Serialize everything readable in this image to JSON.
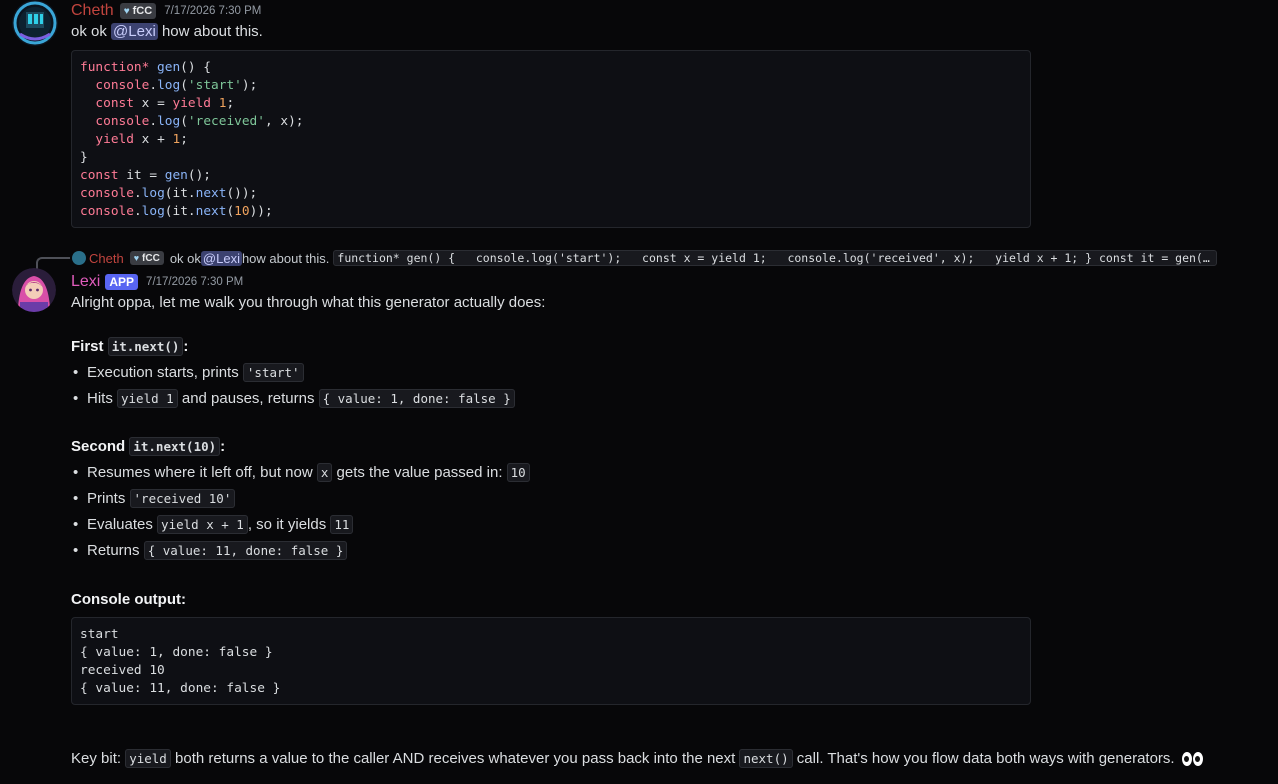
{
  "message1": {
    "author": "Cheth",
    "tag": "fCC",
    "timestamp": "7/17/2026 7:30 PM",
    "text_before": "ok ok ",
    "mention": "@Lexi",
    "text_after": " how about this.",
    "code_lines": [
      [
        {
          "t": "kw",
          "s": "function* "
        },
        {
          "t": "fn",
          "s": "gen"
        },
        {
          "t": "plain",
          "s": "() {"
        }
      ],
      [
        {
          "t": "plain",
          "s": "  "
        },
        {
          "t": "kw",
          "s": "console"
        },
        {
          "t": "plain",
          "s": "."
        },
        {
          "t": "fn",
          "s": "log"
        },
        {
          "t": "plain",
          "s": "("
        },
        {
          "t": "str",
          "s": "'start'"
        },
        {
          "t": "plain",
          "s": ");"
        }
      ],
      [
        {
          "t": "plain",
          "s": "  "
        },
        {
          "t": "kw",
          "s": "const"
        },
        {
          "t": "plain",
          "s": " x = "
        },
        {
          "t": "kw",
          "s": "yield"
        },
        {
          "t": "plain",
          "s": " "
        },
        {
          "t": "num",
          "s": "1"
        },
        {
          "t": "plain",
          "s": ";"
        }
      ],
      [
        {
          "t": "plain",
          "s": "  "
        },
        {
          "t": "kw",
          "s": "console"
        },
        {
          "t": "plain",
          "s": "."
        },
        {
          "t": "fn",
          "s": "log"
        },
        {
          "t": "plain",
          "s": "("
        },
        {
          "t": "str",
          "s": "'received'"
        },
        {
          "t": "plain",
          "s": ", x);"
        }
      ],
      [
        {
          "t": "plain",
          "s": "  "
        },
        {
          "t": "kw",
          "s": "yield"
        },
        {
          "t": "plain",
          "s": " x + "
        },
        {
          "t": "num",
          "s": "1"
        },
        {
          "t": "plain",
          "s": ";"
        }
      ],
      [
        {
          "t": "plain",
          "s": "}"
        }
      ],
      [
        {
          "t": "kw",
          "s": "const"
        },
        {
          "t": "plain",
          "s": " it = "
        },
        {
          "t": "fn",
          "s": "gen"
        },
        {
          "t": "plain",
          "s": "();"
        }
      ],
      [
        {
          "t": "kw",
          "s": "console"
        },
        {
          "t": "plain",
          "s": "."
        },
        {
          "t": "fn",
          "s": "log"
        },
        {
          "t": "plain",
          "s": "(it."
        },
        {
          "t": "fn",
          "s": "next"
        },
        {
          "t": "plain",
          "s": "());"
        }
      ],
      [
        {
          "t": "kw",
          "s": "console"
        },
        {
          "t": "plain",
          "s": "."
        },
        {
          "t": "fn",
          "s": "log"
        },
        {
          "t": "plain",
          "s": "(it."
        },
        {
          "t": "fn",
          "s": "next"
        },
        {
          "t": "plain",
          "s": "("
        },
        {
          "t": "num",
          "s": "10"
        },
        {
          "t": "plain",
          "s": "));"
        }
      ]
    ]
  },
  "reply_preview": {
    "author": "Cheth",
    "tag": "fCC",
    "text_before": "ok ok ",
    "mention": "@Lexi",
    "text_after": " how about this.",
    "code": "function* gen() {   console.log('start');   const x = yield 1;   console.log('received', x);   yield x + 1; } const it = gen(); console.log(it.next());"
  },
  "message2": {
    "author": "Lexi",
    "app_tag": "APP",
    "timestamp": "7/17/2026 7:30 PM",
    "intro": "Alright oppa, let me walk you through what this generator actually does:",
    "first_heading": "First ",
    "first_code": "it.next()",
    "colon": ":",
    "first_b1_text": "Execution starts, prints ",
    "first_b1_code": "'start'",
    "first_b2_a": "Hits ",
    "first_b2_code1": "yield 1",
    "first_b2_b": " and pauses, returns ",
    "first_b2_code2": "{ value: 1, done: false }",
    "second_heading": "Second ",
    "second_code": "it.next(10)",
    "second_b1_a": "Resumes where it left off, but now ",
    "second_b1_code1": "x",
    "second_b1_b": " gets the value passed in: ",
    "second_b1_code2": "10",
    "second_b2_a": "Prints ",
    "second_b2_code": "'received 10'",
    "second_b3_a": "Evaluates ",
    "second_b3_code1": "yield x + 1",
    "second_b3_b": ", so it yields ",
    "second_b3_code2": "11",
    "second_b4_a": "Returns ",
    "second_b4_code": "{ value: 11, done: false }",
    "console_heading": "Console output:",
    "console_output": "start\n{ value: 1, done: false }\nreceived 10\n{ value: 11, done: false }",
    "key_a": "Key bit: ",
    "key_code1": "yield",
    "key_b": " both returns a value to the caller AND receives whatever you pass back into the next ",
    "key_code2": "next()",
    "key_c": " call. That's how you flow data both ways with generators."
  }
}
